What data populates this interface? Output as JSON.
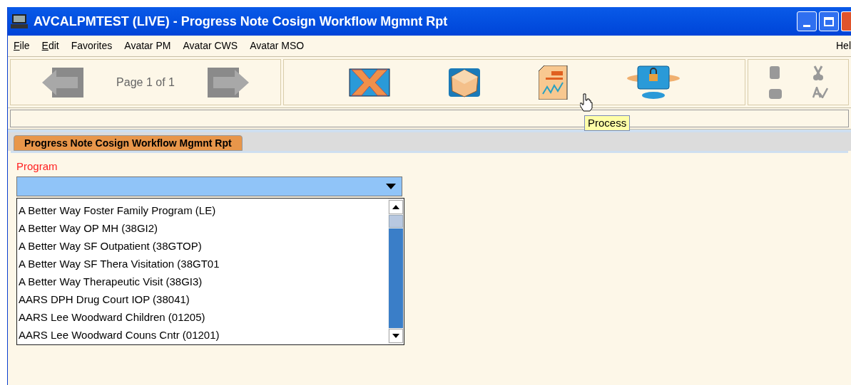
{
  "window": {
    "title": "AVCALPMTEST (LIVE) - Progress Note Cosign Workflow Mgmnt Rpt"
  },
  "menu": [
    {
      "label": "File",
      "mnemonic": true
    },
    {
      "label": "Edit",
      "mnemonic": true
    },
    {
      "label": "Favorites",
      "mnemonic": false
    },
    {
      "label": "Avatar PM",
      "mnemonic": false
    },
    {
      "label": "Avatar CWS",
      "mnemonic": false
    },
    {
      "label": "Avatar MSO",
      "mnemonic": false
    }
  ],
  "help_menu": "Hel",
  "pager": {
    "text": "Page 1 of 1"
  },
  "tooltip": "Process",
  "tabs": [
    {
      "label": "Progress Note Cosign Workflow Mgmnt Rpt",
      "selected": true
    }
  ],
  "program": {
    "label": "Program",
    "required": true,
    "options": [
      "A Better Way Foster Family Program (LE)",
      "A Better Way OP MH (38GI2)",
      "A Better Way SF Outpatient (38GTOP)",
      "A Better Way SF Thera Visitation (38GT01",
      "A Better Way Therapeutic Visit (38GI3)",
      "AARS DPH Drug Court IOP (38041)",
      "AARS Lee Woodward Children (01205)",
      "AARS Lee Woodward Couns Cntr (01201)"
    ]
  }
}
